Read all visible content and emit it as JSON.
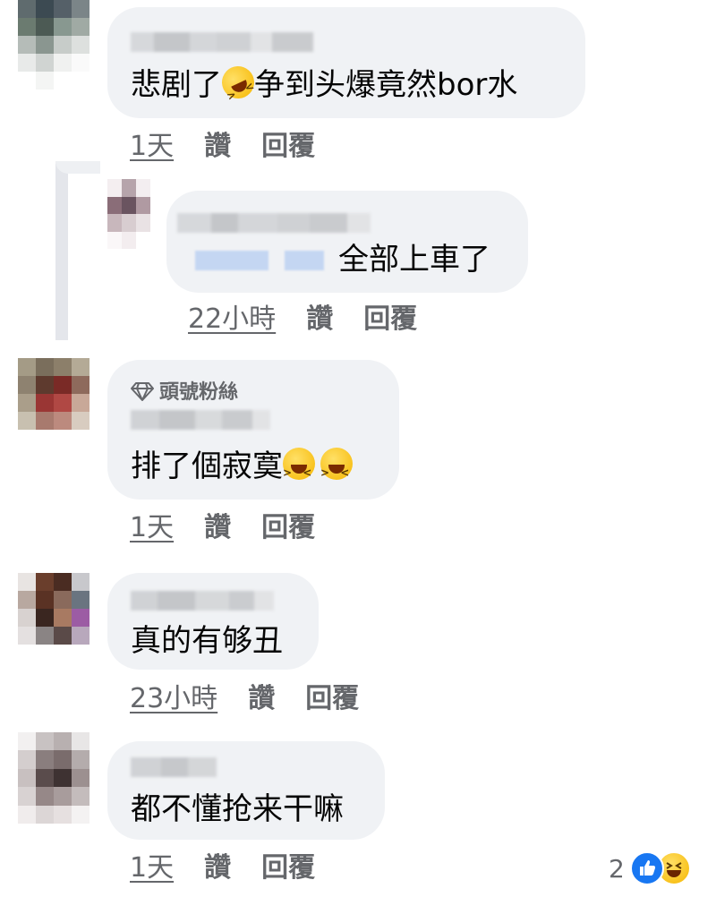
{
  "comments": [
    {
      "text": "悲剧了",
      "text_after_emoji": "争到头爆竟然bor水",
      "emoji": "rolling-on-floor-laughing",
      "time": "1天",
      "like": "讚",
      "reply": "回覆"
    },
    {
      "text": "全部上車了",
      "time": "22小時",
      "like": "讚",
      "reply": "回覆"
    },
    {
      "badge": "頭號粉絲",
      "badge_icon": "diamond-icon",
      "text": "排了個寂寞",
      "emoji": "grinning-squinting-face",
      "time": "1天",
      "like": "讚",
      "reply": "回覆"
    },
    {
      "text": "真的有够丑",
      "time": "23小時",
      "like": "讚",
      "reply": "回覆"
    },
    {
      "text": "都不懂抢来干嘛",
      "time": "1天",
      "like": "讚",
      "reply": "回覆",
      "reaction_count": "2",
      "reaction_icons": [
        "like-icon",
        "haha-icon"
      ]
    }
  ],
  "colors": {
    "bubble": "#f0f2f5",
    "meta_text": "#65676b",
    "like_blue": "#1877f2",
    "emoji_yellow": "#f6b600"
  }
}
